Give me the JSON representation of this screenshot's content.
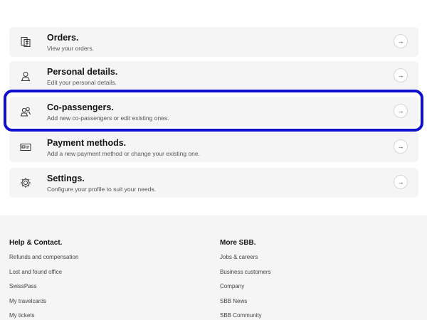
{
  "account_menu": {
    "items": [
      {
        "title": "Orders.",
        "subtitle": "View your orders.",
        "icon": "receipt-icon"
      },
      {
        "title": "Personal details.",
        "subtitle": "Edit your personal details.",
        "icon": "person-icon"
      },
      {
        "title": "Co-passengers.",
        "subtitle": "Add new co-passengers or edit existing ones.",
        "icon": "co-passengers-icon"
      },
      {
        "title": "Payment methods.",
        "subtitle": "Add a new payment method or change your existing one.",
        "icon": "payment-card-icon"
      },
      {
        "title": "Settings.",
        "subtitle": "Configure your profile to suit your needs.",
        "icon": "gear-icon"
      }
    ],
    "arrow_glyph": "→",
    "highlight_color": "#0f0fd0"
  },
  "footer": {
    "help": {
      "heading": "Help & Contact.",
      "links": [
        "Refunds and compensation",
        "Lost and found office",
        "SwissPass",
        "My travelcards",
        "My tickets"
      ]
    },
    "more": {
      "heading": "More SBB.",
      "links": [
        "Jobs & careers",
        "Business customers",
        "Company",
        "SBB News",
        "SBB Community"
      ]
    }
  }
}
